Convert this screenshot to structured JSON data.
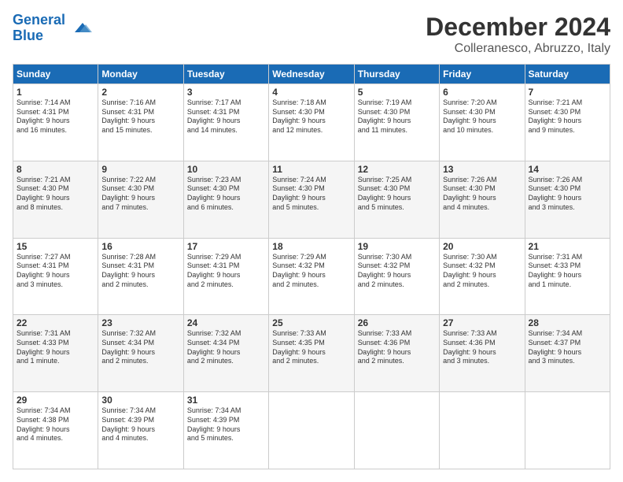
{
  "logo": {
    "line1": "General",
    "line2": "Blue"
  },
  "title": "December 2024",
  "location": "Colleranesco, Abruzzo, Italy",
  "days_header": [
    "Sunday",
    "Monday",
    "Tuesday",
    "Wednesday",
    "Thursday",
    "Friday",
    "Saturday"
  ],
  "weeks": [
    [
      {
        "day": "1",
        "sunrise": "7:14 AM",
        "sunset": "4:31 PM",
        "daylight": "9 hours and 16 minutes."
      },
      {
        "day": "2",
        "sunrise": "7:16 AM",
        "sunset": "4:31 PM",
        "daylight": "9 hours and 15 minutes."
      },
      {
        "day": "3",
        "sunrise": "7:17 AM",
        "sunset": "4:31 PM",
        "daylight": "9 hours and 14 minutes."
      },
      {
        "day": "4",
        "sunrise": "7:18 AM",
        "sunset": "4:30 PM",
        "daylight": "9 hours and 12 minutes."
      },
      {
        "day": "5",
        "sunrise": "7:19 AM",
        "sunset": "4:30 PM",
        "daylight": "9 hours and 11 minutes."
      },
      {
        "day": "6",
        "sunrise": "7:20 AM",
        "sunset": "4:30 PM",
        "daylight": "9 hours and 10 minutes."
      },
      {
        "day": "7",
        "sunrise": "7:21 AM",
        "sunset": "4:30 PM",
        "daylight": "9 hours and 9 minutes."
      }
    ],
    [
      {
        "day": "8",
        "sunrise": "7:21 AM",
        "sunset": "4:30 PM",
        "daylight": "9 hours and 8 minutes."
      },
      {
        "day": "9",
        "sunrise": "7:22 AM",
        "sunset": "4:30 PM",
        "daylight": "9 hours and 7 minutes."
      },
      {
        "day": "10",
        "sunrise": "7:23 AM",
        "sunset": "4:30 PM",
        "daylight": "9 hours and 6 minutes."
      },
      {
        "day": "11",
        "sunrise": "7:24 AM",
        "sunset": "4:30 PM",
        "daylight": "9 hours and 5 minutes."
      },
      {
        "day": "12",
        "sunrise": "7:25 AM",
        "sunset": "4:30 PM",
        "daylight": "9 hours and 5 minutes."
      },
      {
        "day": "13",
        "sunrise": "7:26 AM",
        "sunset": "4:30 PM",
        "daylight": "9 hours and 4 minutes."
      },
      {
        "day": "14",
        "sunrise": "7:26 AM",
        "sunset": "4:30 PM",
        "daylight": "9 hours and 3 minutes."
      }
    ],
    [
      {
        "day": "15",
        "sunrise": "7:27 AM",
        "sunset": "4:31 PM",
        "daylight": "9 hours and 3 minutes."
      },
      {
        "day": "16",
        "sunrise": "7:28 AM",
        "sunset": "4:31 PM",
        "daylight": "9 hours and 2 minutes."
      },
      {
        "day": "17",
        "sunrise": "7:29 AM",
        "sunset": "4:31 PM",
        "daylight": "9 hours and 2 minutes."
      },
      {
        "day": "18",
        "sunrise": "7:29 AM",
        "sunset": "4:32 PM",
        "daylight": "9 hours and 2 minutes."
      },
      {
        "day": "19",
        "sunrise": "7:30 AM",
        "sunset": "4:32 PM",
        "daylight": "9 hours and 2 minutes."
      },
      {
        "day": "20",
        "sunrise": "7:30 AM",
        "sunset": "4:32 PM",
        "daylight": "9 hours and 2 minutes."
      },
      {
        "day": "21",
        "sunrise": "7:31 AM",
        "sunset": "4:33 PM",
        "daylight": "9 hours and 1 minute."
      }
    ],
    [
      {
        "day": "22",
        "sunrise": "7:31 AM",
        "sunset": "4:33 PM",
        "daylight": "9 hours and 1 minute."
      },
      {
        "day": "23",
        "sunrise": "7:32 AM",
        "sunset": "4:34 PM",
        "daylight": "9 hours and 2 minutes."
      },
      {
        "day": "24",
        "sunrise": "7:32 AM",
        "sunset": "4:34 PM",
        "daylight": "9 hours and 2 minutes."
      },
      {
        "day": "25",
        "sunrise": "7:33 AM",
        "sunset": "4:35 PM",
        "daylight": "9 hours and 2 minutes."
      },
      {
        "day": "26",
        "sunrise": "7:33 AM",
        "sunset": "4:36 PM",
        "daylight": "9 hours and 2 minutes."
      },
      {
        "day": "27",
        "sunrise": "7:33 AM",
        "sunset": "4:36 PM",
        "daylight": "9 hours and 3 minutes."
      },
      {
        "day": "28",
        "sunrise": "7:34 AM",
        "sunset": "4:37 PM",
        "daylight": "9 hours and 3 minutes."
      }
    ],
    [
      {
        "day": "29",
        "sunrise": "7:34 AM",
        "sunset": "4:38 PM",
        "daylight": "9 hours and 4 minutes."
      },
      {
        "day": "30",
        "sunrise": "7:34 AM",
        "sunset": "4:39 PM",
        "daylight": "9 hours and 4 minutes."
      },
      {
        "day": "31",
        "sunrise": "7:34 AM",
        "sunset": "4:39 PM",
        "daylight": "9 hours and 5 minutes."
      },
      null,
      null,
      null,
      null
    ]
  ]
}
